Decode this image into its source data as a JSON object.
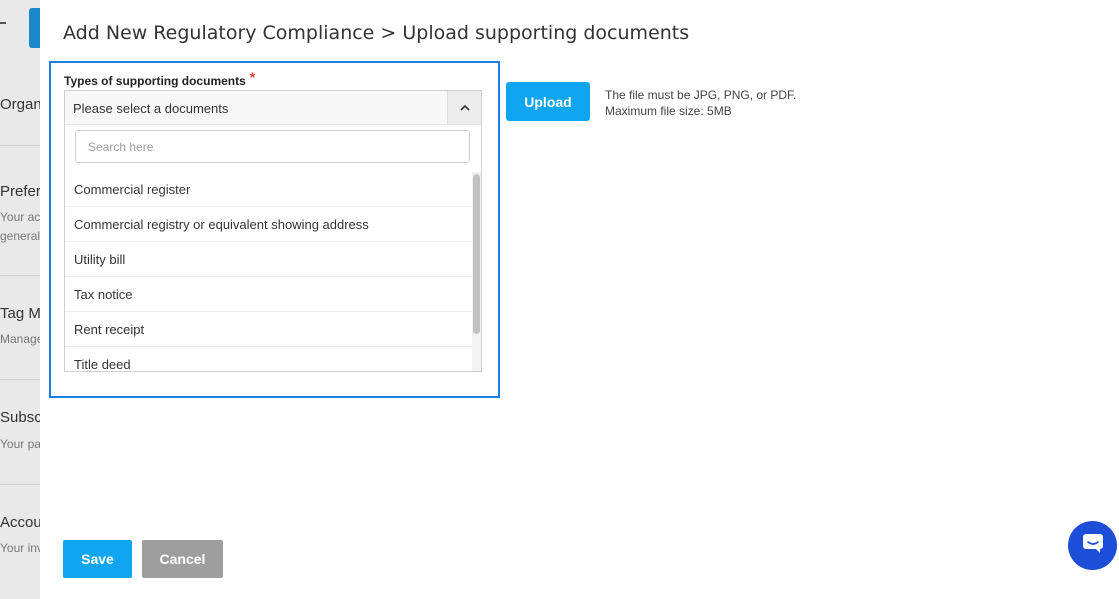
{
  "background": {
    "items": [
      {
        "title": "Organ",
        "desc": ""
      },
      {
        "title": "Prefer",
        "desc": "Your ac",
        "desc2": "general"
      },
      {
        "title": "Tag Ma",
        "desc": "Manage"
      },
      {
        "title": "Subscr",
        "desc": "Your pa"
      },
      {
        "title": "Accou",
        "desc": "Your inv"
      }
    ]
  },
  "modal": {
    "title": "Add New Regulatory Compliance > Upload supporting documents",
    "field_label": "Types of supporting documents",
    "required_mark": "*",
    "dropdown": {
      "placeholder": "Please select a documents",
      "search_placeholder": "Search here",
      "options": [
        "Commercial register",
        "Commercial registry or equivalent showing address",
        "Utility bill",
        "Tax notice",
        "Rent receipt",
        "Title deed"
      ]
    },
    "upload_label": "Upload",
    "hint_line1": "The file must be JPG, PNG, or PDF.",
    "hint_line2": "Maximum file size: 5MB",
    "save_label": "Save",
    "cancel_label": "Cancel"
  },
  "colors": {
    "accent": "#0fa5f0",
    "focus_border": "#1a7fe6",
    "cancel": "#9e9e9e",
    "required": "#e53935",
    "chat": "#1d4ed8"
  },
  "icons": {
    "chevron": "chevron-up-icon",
    "chat": "chat-bubble-icon",
    "menu": "menu-icon"
  }
}
